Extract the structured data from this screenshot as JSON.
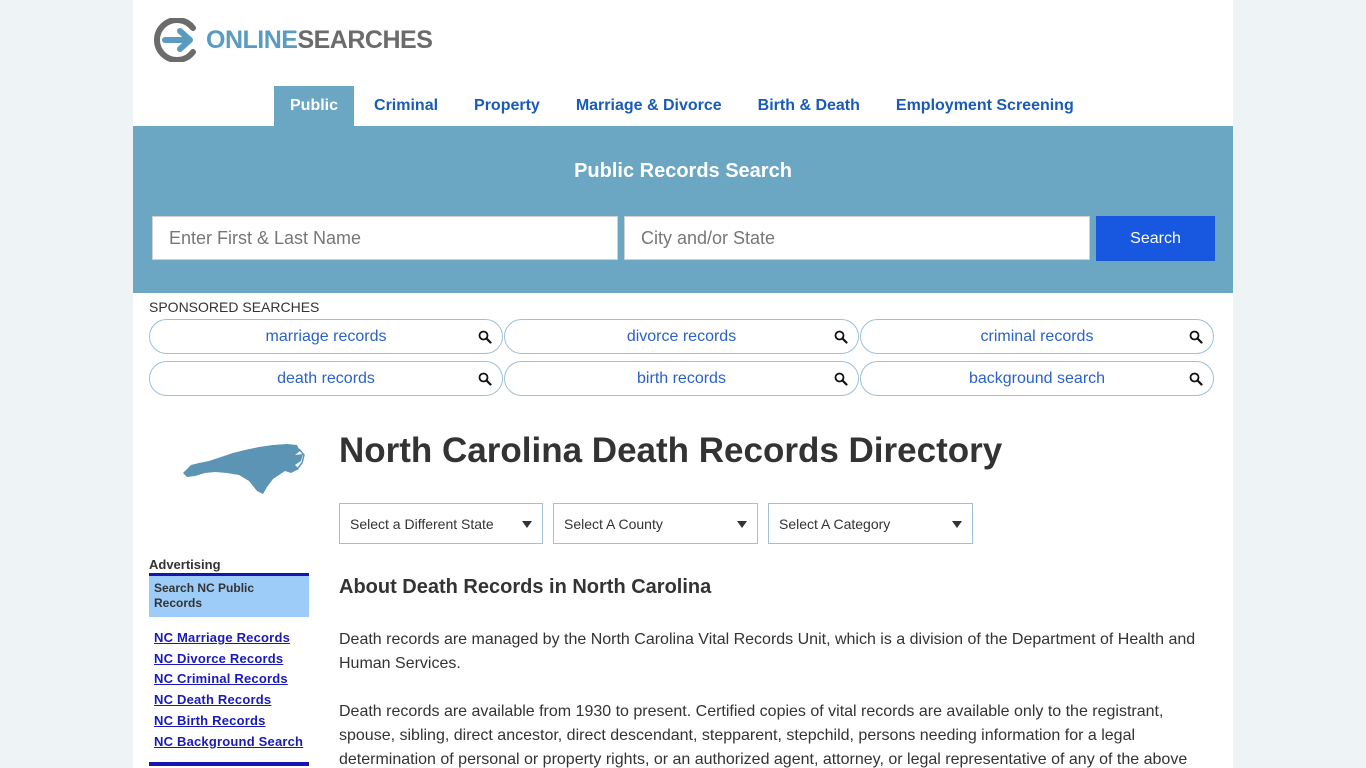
{
  "logo": {
    "part1": "ONLINE",
    "part2": "SEARCHES"
  },
  "nav": [
    {
      "label": "Public",
      "active": true
    },
    {
      "label": "Criminal",
      "active": false
    },
    {
      "label": "Property",
      "active": false
    },
    {
      "label": "Marriage & Divorce",
      "active": false
    },
    {
      "label": "Birth & Death",
      "active": false
    },
    {
      "label": "Employment Screening",
      "active": false
    }
  ],
  "search": {
    "title": "Public Records Search",
    "name_placeholder": "Enter First & Last Name",
    "location_placeholder": "City and/or State",
    "button": "Search"
  },
  "sponsored": {
    "label": "SPONSORED SEARCHES",
    "items": [
      "marriage records",
      "divorce records",
      "criminal records",
      "death records",
      "birth records",
      "background search"
    ]
  },
  "sidebar": {
    "advertising_label": "Advertising",
    "box_title": "Search NC Public Records",
    "links": [
      "NC Marriage Records",
      "NC Divorce Records",
      "NC Criminal Records",
      "NC Death Records",
      "NC Birth Records",
      "NC Background Search"
    ]
  },
  "main": {
    "title": "North Carolina Death Records Directory",
    "selects": [
      "Select a Different State",
      "Select A County",
      "Select A Category"
    ],
    "section_title": "About Death Records in North Carolina",
    "paragraphs": [
      "Death records are managed by the North Carolina Vital Records Unit, which is a division of the Department of Health and Human Services.",
      "Death records are available from 1930 to present. Certified copies of vital records are available only to the registrant, spouse, sibling, direct ancestor, direct descendant, stepparent, stepchild, persons needing information for a legal determination of personal or property rights, or an authorized agent, attorney, or legal representative of any of the above"
    ]
  },
  "colors": {
    "accent": "#6ba6c2",
    "button": "#1858e0",
    "link": "#1a5bb8",
    "ad_box": "#9dccf8",
    "ad_border": "#1515b0"
  }
}
